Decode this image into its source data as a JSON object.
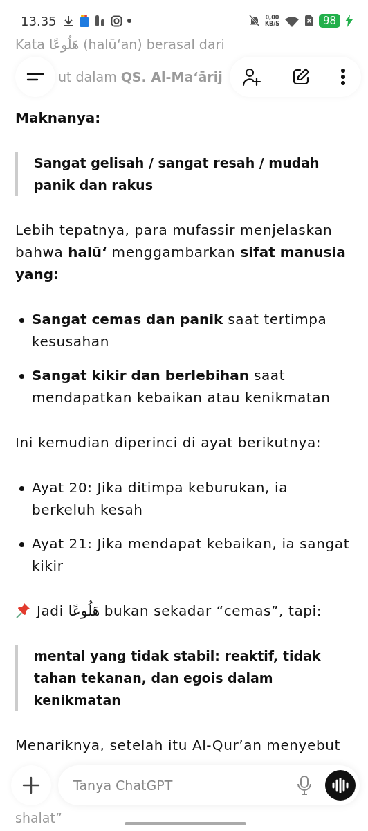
{
  "status_bar": {
    "time": "13.35",
    "net_speed": "0,00",
    "net_unit": "KB/S",
    "battery": "98",
    "charging": true
  },
  "faded_top": [
    "Kata هَلُوعًا (halū‘an) berasal dari",
    "ut dalam **QS. Al-Ma‘ārij**"
  ],
  "blocks": [
    {
      "kind": "paragraph",
      "text": "**Maknanya:**"
    },
    {
      "kind": "quote",
      "text": "Sangat gelisah / sangat resah / mudah panik dan rakus"
    },
    {
      "kind": "paragraph",
      "text": "Lebih tepatnya, para mufassir menjelaskan bahwa **halū‘** menggambarkan **sifat manusia yang:**"
    },
    {
      "kind": "bullets",
      "items": [
        "**Sangat cemas dan panik** saat tertimpa kesusahan",
        "**Sangat kikir dan berlebihan** saat mendapatkan kebaikan atau kenikmatan"
      ]
    },
    {
      "kind": "paragraph",
      "text": "Ini kemudian diperinci di ayat berikutnya:"
    },
    {
      "kind": "bullets",
      "items": [
        "Ayat 20: Jika ditimpa keburukan, ia berkeluh kesah",
        "Ayat 21: Jika mendapat kebaikan, ia sangat kikir"
      ]
    },
    {
      "kind": "pin",
      "text": "Jadi هَلُوعًا bukan sekadar “cemas”, tapi:"
    },
    {
      "kind": "quote",
      "text": "mental yang tidak stabil: reaktif, tidak tahan tekanan, dan egois dalam kenikmatan"
    },
    {
      "kind": "paragraph",
      "text": "Menariknya, setelah itu Al-Qur’an menyebut"
    }
  ],
  "composer": {
    "placeholder": "Tanya ChatGPT"
  },
  "faded_bottom": "shalat”"
}
